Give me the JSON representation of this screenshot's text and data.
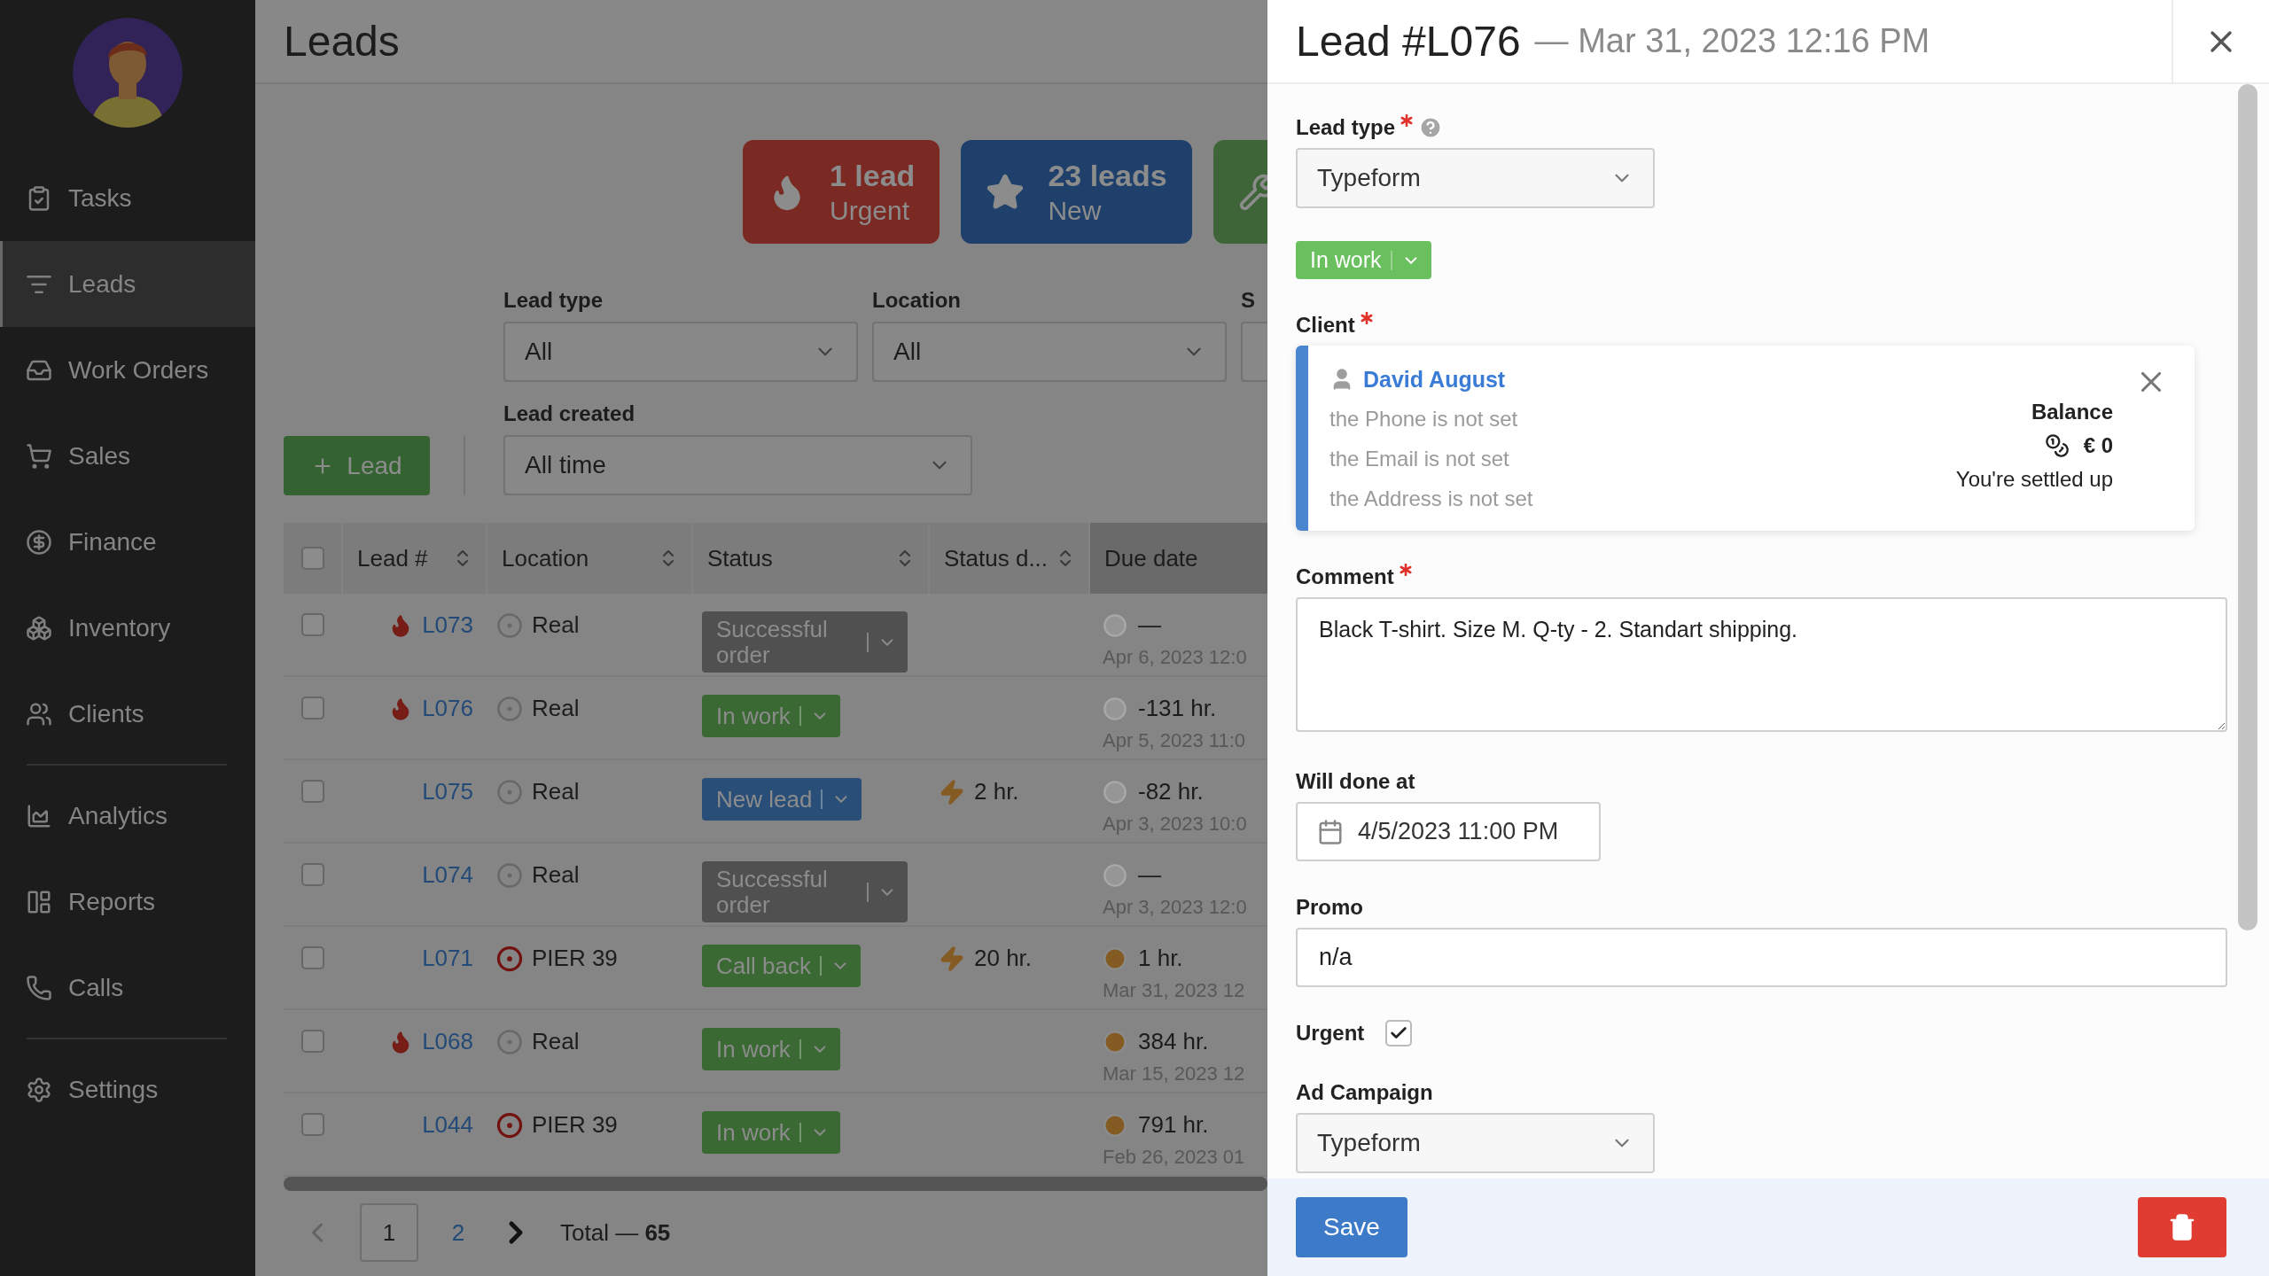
{
  "sidebar": {
    "sections": [
      {
        "items": [
          {
            "label": "Tasks",
            "selected": false
          },
          {
            "label": "Leads",
            "selected": true
          },
          {
            "label": "Work Orders",
            "selected": false
          },
          {
            "label": "Sales",
            "selected": false
          },
          {
            "label": "Finance",
            "selected": false
          },
          {
            "label": "Inventory",
            "selected": false
          },
          {
            "label": "Clients",
            "selected": false
          }
        ]
      },
      {
        "items": [
          {
            "label": "Analytics",
            "selected": false
          },
          {
            "label": "Reports",
            "selected": false
          },
          {
            "label": "Calls",
            "selected": false
          }
        ]
      },
      {
        "items": [
          {
            "label": "Settings",
            "selected": false
          }
        ]
      }
    ]
  },
  "page": {
    "title": "Leads"
  },
  "stat_cards": [
    {
      "count": "1 lead",
      "label": "Urgent",
      "color": "#7b2923"
    },
    {
      "count": "23 leads",
      "label": "New",
      "color": "#20406c"
    },
    {
      "color": "#3d6538"
    }
  ],
  "filters": [
    {
      "label": "Lead type",
      "value": "All"
    },
    {
      "label": "Location",
      "value": "All"
    },
    {
      "label": "S"
    }
  ],
  "lead_created": {
    "label": "Lead created",
    "value": "All time"
  },
  "add_button": "Lead",
  "table": {
    "all_checked": false,
    "columns": [
      {
        "label": "Lead #",
        "sortable": true,
        "sorted": false
      },
      {
        "label": "Location",
        "sortable": true,
        "sorted": false
      },
      {
        "label": "Status",
        "sortable": true,
        "sorted": false
      },
      {
        "label": "Status d...",
        "sortable": true,
        "sorted": false
      },
      {
        "label": "Due date",
        "sortable": false,
        "sorted": true
      }
    ],
    "rows": [
      {
        "checked": false,
        "urgent": true,
        "lead": "L073",
        "location": "Real",
        "location_marked": false,
        "status": {
          "label": "Successful order",
          "color": "#505050"
        },
        "due": "—",
        "due_active": false,
        "due_date": "Apr 6, 2023 12:0"
      },
      {
        "checked": false,
        "urgent": true,
        "lead": "L076",
        "location": "Real",
        "location_marked": false,
        "status": {
          "label": "In work",
          "color": "#3a6934"
        },
        "due": "-131 hr.",
        "due_active": false,
        "due_date": "Apr 5, 2023 11:0"
      },
      {
        "checked": false,
        "urgent": false,
        "lead": "L075",
        "location": "Real",
        "location_marked": false,
        "status": {
          "label": "New lead",
          "color": "#294f79"
        },
        "timer": "2 hr.",
        "due": "-82 hr.",
        "due_active": false,
        "due_date": "Apr 3, 2023 10:0"
      },
      {
        "checked": false,
        "urgent": false,
        "lead": "L074",
        "location": "Real",
        "location_marked": false,
        "status": {
          "label": "Successful order",
          "color": "#505050"
        },
        "due": "—",
        "due_active": false,
        "due_date": "Apr 3, 2023 12:0"
      },
      {
        "checked": false,
        "urgent": false,
        "lead": "L071",
        "location": "PIER 39",
        "location_marked": true,
        "status": {
          "label": "Call back",
          "color": "#3a6934"
        },
        "timer": "20 hr.",
        "due": "1 hr.",
        "due_active": true,
        "due_date": "Mar 31, 2023 12"
      },
      {
        "checked": false,
        "urgent": true,
        "lead": "L068",
        "location": "Real",
        "location_marked": false,
        "status": {
          "label": "In work",
          "color": "#3a6934"
        },
        "due": "384 hr.",
        "due_active": true,
        "due_date": "Mar 15, 2023 12"
      },
      {
        "checked": false,
        "urgent": false,
        "lead": "L044",
        "location": "PIER 39",
        "location_marked": true,
        "status": {
          "label": "In work",
          "color": "#3a6934"
        },
        "due": "791 hr.",
        "due_active": true,
        "due_date": "Feb 26, 2023 01"
      }
    ]
  },
  "pagination": {
    "pages": [
      {
        "label": "1",
        "selected": true
      },
      {
        "label": "2",
        "selected": false
      }
    ],
    "total": "Total — **65**"
  },
  "panel": {
    "title": "Lead #L076",
    "subtitle": "— Mar 31, 2023 12:16 PM",
    "fields": [
      {
        "kind": "select",
        "label": "Lead type",
        "required": true,
        "help": true,
        "value": "Typeform"
      },
      {
        "kind": "status",
        "value": "In work",
        "color": "#6abf5e"
      },
      {
        "kind": "client",
        "label": "Client",
        "required": true,
        "name": "David August",
        "details": [
          "the Phone is not set",
          "the Email is not set",
          "the Address is not set"
        ],
        "balance_label": "Balance",
        "balance": "€ 0",
        "balance_note": "You're settled up"
      },
      {
        "kind": "textarea",
        "label": "Comment",
        "required": true,
        "value": "Black T-shirt. Size M. Q-ty - 2. Standart shipping."
      },
      {
        "kind": "date",
        "label": "Will done at",
        "required": false,
        "value": "4/5/2023 11:00 PM"
      },
      {
        "kind": "text",
        "label": "Promo",
        "required": false,
        "value": "n/a"
      },
      {
        "kind": "checkbox",
        "label": "Urgent",
        "required": false,
        "checked": true
      },
      {
        "kind": "select",
        "label": "Ad Campaign",
        "required": false,
        "value": "Typeform"
      }
    ],
    "save": "Save"
  }
}
